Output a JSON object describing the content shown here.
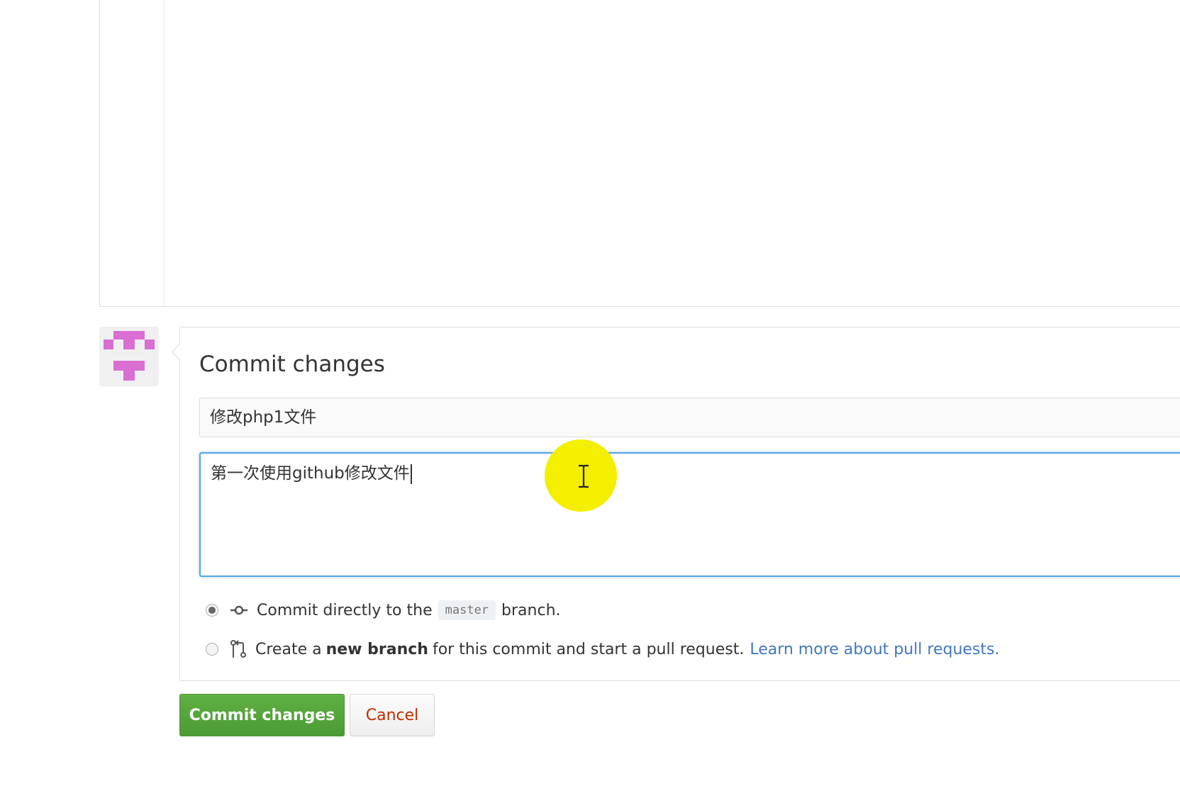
{
  "commit": {
    "heading": "Commit changes",
    "summary_value": "修改php1文件",
    "description_value": "第一次使用github修改文件"
  },
  "options": {
    "direct": {
      "prefix": "Commit directly to the",
      "branch": "master",
      "suffix": "branch.",
      "checked": true
    },
    "new_branch": {
      "prefix": "Create a",
      "bold": "new branch",
      "suffix": "for this commit and start a pull request.",
      "link": "Learn more about pull requests.",
      "checked": false
    }
  },
  "buttons": {
    "commit_label": "Commit changes",
    "cancel_label": "Cancel"
  },
  "icons": {
    "avatar": "identicon-avatar",
    "commit": "git-commit-icon",
    "pull_request": "git-pull-request-icon",
    "cursor": "text-cursor-icon"
  },
  "colors": {
    "commit_button": "#4c9a34",
    "cancel_text": "#bd2c00",
    "link": "#4078c0",
    "focus_border": "#51a7e8",
    "cursor_highlight": "#f4ee00",
    "avatar_pink": "#d96fd2"
  }
}
